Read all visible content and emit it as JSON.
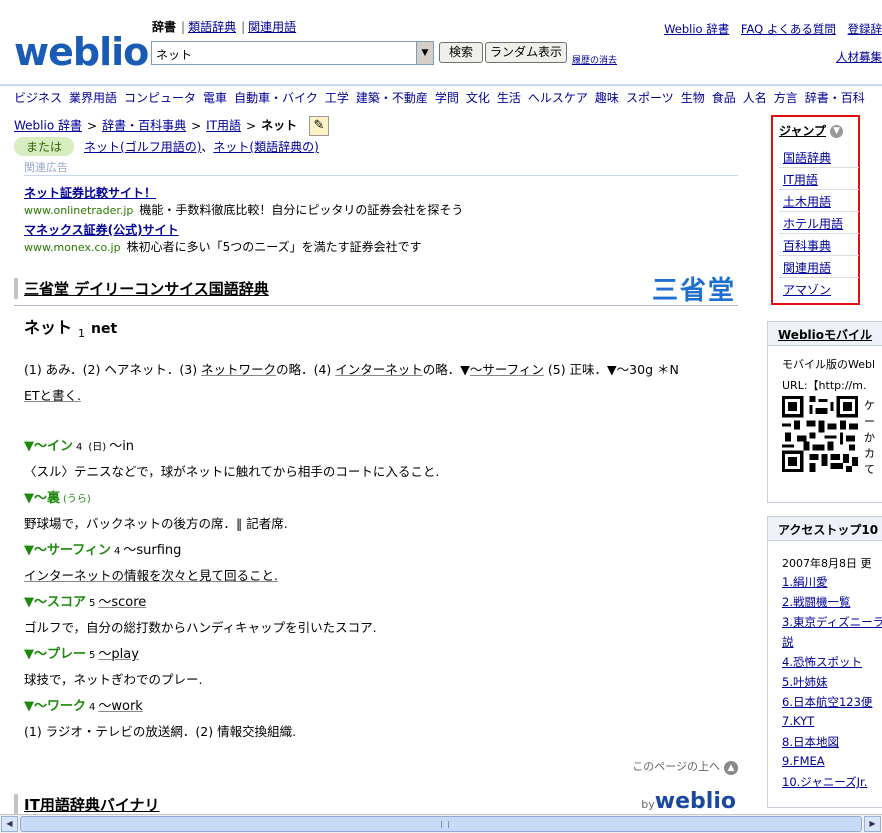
{
  "header": {
    "logo": "weblio",
    "dict_tabs": [
      "辞書",
      "類語辞典",
      "関連用語"
    ],
    "search_value": "ネット",
    "search_button": "検索",
    "random_button": "ランダム表示",
    "clear_history": "履歴の消去",
    "top_links": [
      "Weblio 辞書",
      "FAQ よくある質問",
      "登録辞"
    ],
    "hr_link": "人材募集"
  },
  "categories": [
    "ビジネス",
    "業界用語",
    "コンピュータ",
    "電車",
    "自動車・バイク",
    "工学",
    "建築・不動産",
    "学問",
    "文化",
    "生活",
    "ヘルスケア",
    "趣味",
    "スポーツ",
    "生物",
    "食品",
    "人名",
    "方言",
    "辞書・百科"
  ],
  "breadcrumb": [
    "Weblio 辞書",
    "辞書・百科事典",
    "IT用語",
    "ネット"
  ],
  "alt": {
    "badge": "または",
    "text1": "ネット(ゴルフ用語の)",
    "sep": "、",
    "text2": "ネット(類語辞典の)"
  },
  "ads": {
    "label": "関連広告",
    "items": [
      {
        "title": "ネット証券比較サイト！",
        "url": "www.onlinetrader.jp",
        "desc": "機能・手数料徹底比較！自分にピッタリの証券会社を探そう"
      },
      {
        "title": "マネックス証券(公式)サイト",
        "url": "www.monex.co.jp",
        "desc": "株初心者に多い「5つのニーズ」を満たす証券会社です"
      }
    ]
  },
  "section1": {
    "title": "三省堂 デイリーコンサイス国語辞典",
    "logo": "三省堂"
  },
  "entry": {
    "word": "ネット",
    "num": "1",
    "english": "net",
    "def1_a": "(1) あみ．(2) ヘアネット．(3) ",
    "def1_b": "ネットワーク",
    "def1_c": "の略．(4) ",
    "def1_d": "インターネット",
    "def1_e": "の略．▼",
    "def1_f": "～サーフィン",
    "def1_g": " (5) 正味．▼～30g ＊N",
    "def1_h": "ETと書く.",
    "subs": [
      {
        "head": "▼～イン",
        "num": "4",
        "mark": "(日)",
        "en": "～in",
        "text": "〈スル〉テニスなどで，球がネットに触れてから相手のコートに入ること."
      },
      {
        "head": "▼～裏",
        "num": "",
        "mark": "(うら)",
        "en": "",
        "text": "野球場で，バックネットの後方の席．‖ 記者席."
      },
      {
        "head": "▼～サーフィン",
        "num": "4",
        "mark": "",
        "en": "～surfing",
        "text": "インターネットの情報を次々と見て回ること."
      },
      {
        "head": "▼～スコア",
        "num": "5",
        "mark": "",
        "en": "～score",
        "text": "ゴルフで，自分の総打数からハンディキャップを引いたスコア."
      },
      {
        "head": "▼～プレー",
        "num": "5",
        "mark": "",
        "en": "～play",
        "text": "球技で，ネットぎわでのプレー."
      },
      {
        "head": "▼～ワーク",
        "num": "4",
        "mark": "",
        "en": "～work",
        "text": "(1) ラジオ・テレビの放送網．(2) 情報交換組織."
      }
    ]
  },
  "page_top": "このページの上へ",
  "section2": {
    "title": "IT用語辞典バイナリ",
    "by": "by",
    "logo": "weblio"
  },
  "sidebar": {
    "jump_title": "ジャンプ",
    "jump_items": [
      "国語辞典",
      "IT用語",
      "土木用語",
      "ホテル用語",
      "百科事典",
      "関連用語",
      "アマゾン"
    ],
    "mobile_title": "Weblioモバイル",
    "mobile_text1": "モバイル版のWebl",
    "mobile_text2": "URL:【http://m.",
    "qr_side": [
      "ケ",
      "ー",
      "か",
      "カ",
      "て"
    ],
    "access_title": "アクセストップ10",
    "access_date": "2007年8月8日 更",
    "ranks": [
      "1.絹川愛",
      "2.戦闘機一覧",
      "3.東京ディズニーラ",
      "説",
      "4.恐怖スポット",
      "5.叶姉妹",
      "6.日本航空123便",
      "7.KYT",
      "8.日本地図",
      "9.FMEA",
      "10.ジャニーズJr."
    ]
  }
}
